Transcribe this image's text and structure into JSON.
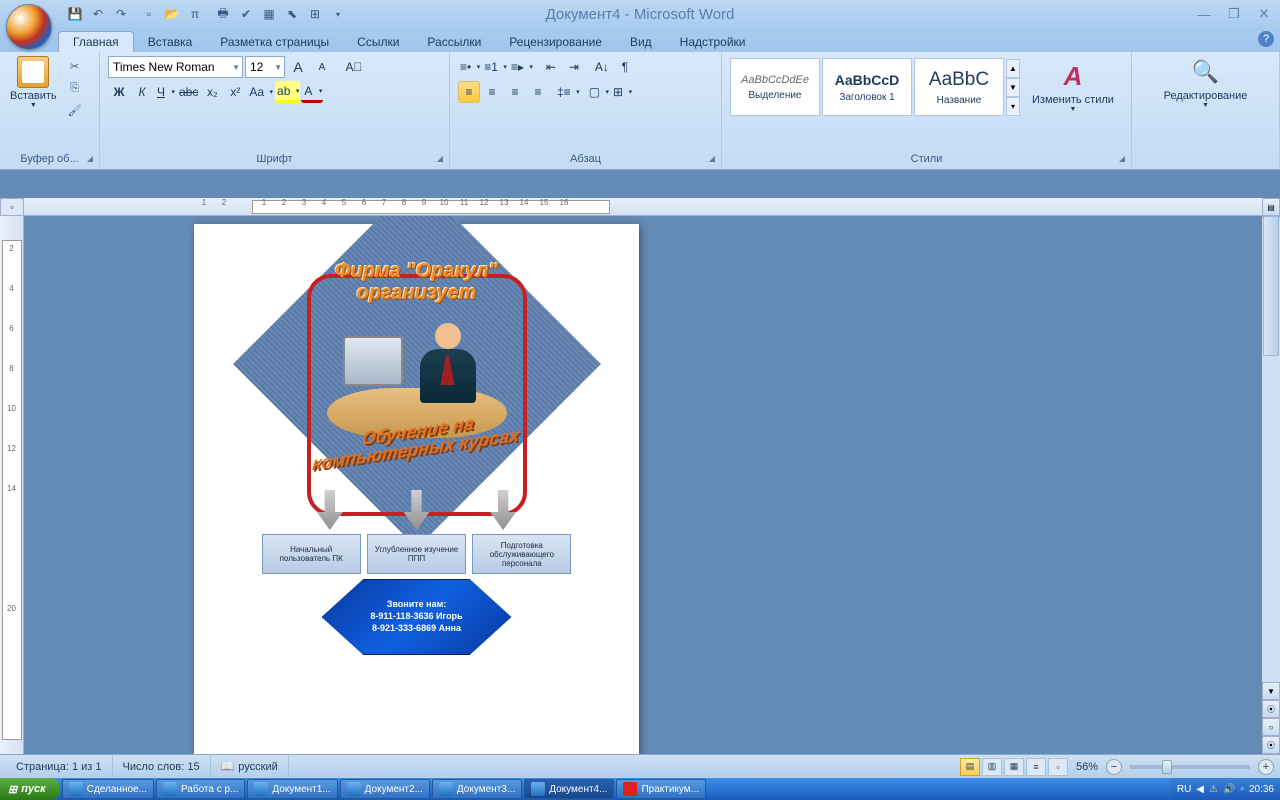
{
  "title": "Документ4 - Microsoft Word",
  "tabs": [
    "Главная",
    "Вставка",
    "Разметка страницы",
    "Ссылки",
    "Рассылки",
    "Рецензирование",
    "Вид",
    "Надстройки"
  ],
  "active_tab": 0,
  "clipboard": {
    "paste": "Вставить",
    "label": "Буфер об..."
  },
  "font": {
    "name": "Times New Roman",
    "size": "12",
    "label": "Шрифт",
    "bold": "Ж",
    "italic": "К",
    "underline": "Ч",
    "strike": "abc",
    "sub": "x₂",
    "sup": "x²",
    "case": "Aa",
    "grow": "A",
    "shrink": "A",
    "clear": "A₿",
    "highlight": "ab",
    "color": "A"
  },
  "para": {
    "label": "Абзац"
  },
  "styles": {
    "label": "Стили",
    "items": [
      {
        "preview": "AaBbCcDdEe",
        "name": "Выделение",
        "style": "italic"
      },
      {
        "preview": "AaBbCcD",
        "name": "Заголовок 1",
        "style": "bold"
      },
      {
        "preview": "AaBbC",
        "name": "Название",
        "style": "big"
      }
    ],
    "change": "Изменить стили"
  },
  "editing": {
    "label": "Редактирование"
  },
  "doc": {
    "wordart1_l1": "Фирма \"Оракул\"",
    "wordart1_l2": "организует",
    "wordart2_l1": "Обучение на",
    "wordart2_l2": "компьютерных курсах",
    "box1": "Начальный пользователь ПК",
    "box2": "Углубленное изучение ППП",
    "box3": "Подготовка обслуживающего персонала",
    "hex_l1": "Звоните нам:",
    "hex_l2": "8-911-118-3636 Игорь",
    "hex_l3": "8-921-333-6869 Анна"
  },
  "status": {
    "page": "Страница: 1 из 1",
    "words": "Число слов: 15",
    "lang": "русский",
    "zoom": "56%"
  },
  "taskbar": {
    "start": "пуск",
    "items": [
      "Сделанное...",
      "Работа с р...",
      "Документ1...",
      "Документ2...",
      "Документ3...",
      "Документ4...",
      "Практикум..."
    ],
    "active_item": 5,
    "lang": "RU",
    "time": "20:36"
  },
  "ruler_h": [
    "1",
    "2",
    "",
    "1",
    "2",
    "3",
    "4",
    "5",
    "6",
    "7",
    "8",
    "9",
    "10",
    "11",
    "12",
    "13",
    "14",
    "15",
    "16"
  ],
  "ruler_v": [
    "",
    "2",
    "",
    "4",
    "",
    "6",
    "",
    "8",
    "",
    "10",
    "",
    "12",
    "",
    "14",
    "",
    "",
    "",
    "",
    "",
    "20"
  ]
}
